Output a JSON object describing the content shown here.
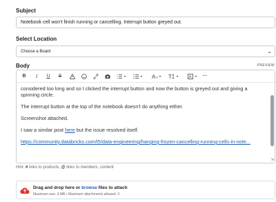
{
  "subject": {
    "label": "Subject",
    "value": "Notebook cell won't finish running or cancelling. Interrupt button greyed out."
  },
  "location": {
    "label": "Select Location",
    "selected": "Choose a Board"
  },
  "body": {
    "label": "Body",
    "preview_label": "PREVIEW",
    "paragraphs": {
      "p1": "considered too long and so I clicked the interrupt button and now the button is greyed out and giving a spinning circle.",
      "p2": "The interrupt button at the top of the notebook doesn't do anything either.",
      "p3": "Screenshot attached.",
      "p4_before": "I saw a similar post ",
      "p4_link": "here",
      "p4_after": " but the issue resolved itself.",
      "p5_link": "https://community.databricks.com/t5/data-engineering/hanging-frozen-cancelling-running-cells-in-note..."
    }
  },
  "hint": {
    "prefix": "Hint:",
    "hash_symbol": "#",
    "hash_text": "links to products,",
    "at_symbol": "@",
    "at_text": "links to members, content"
  },
  "attachment": {
    "line1_before": "Drag and drop here or ",
    "line1_browse": "browse",
    "line1_after": " files to attach",
    "line2": "Maximum size: 9 MB • Maximum attachments allowed: 3",
    "icon_color": "#e0322b"
  }
}
